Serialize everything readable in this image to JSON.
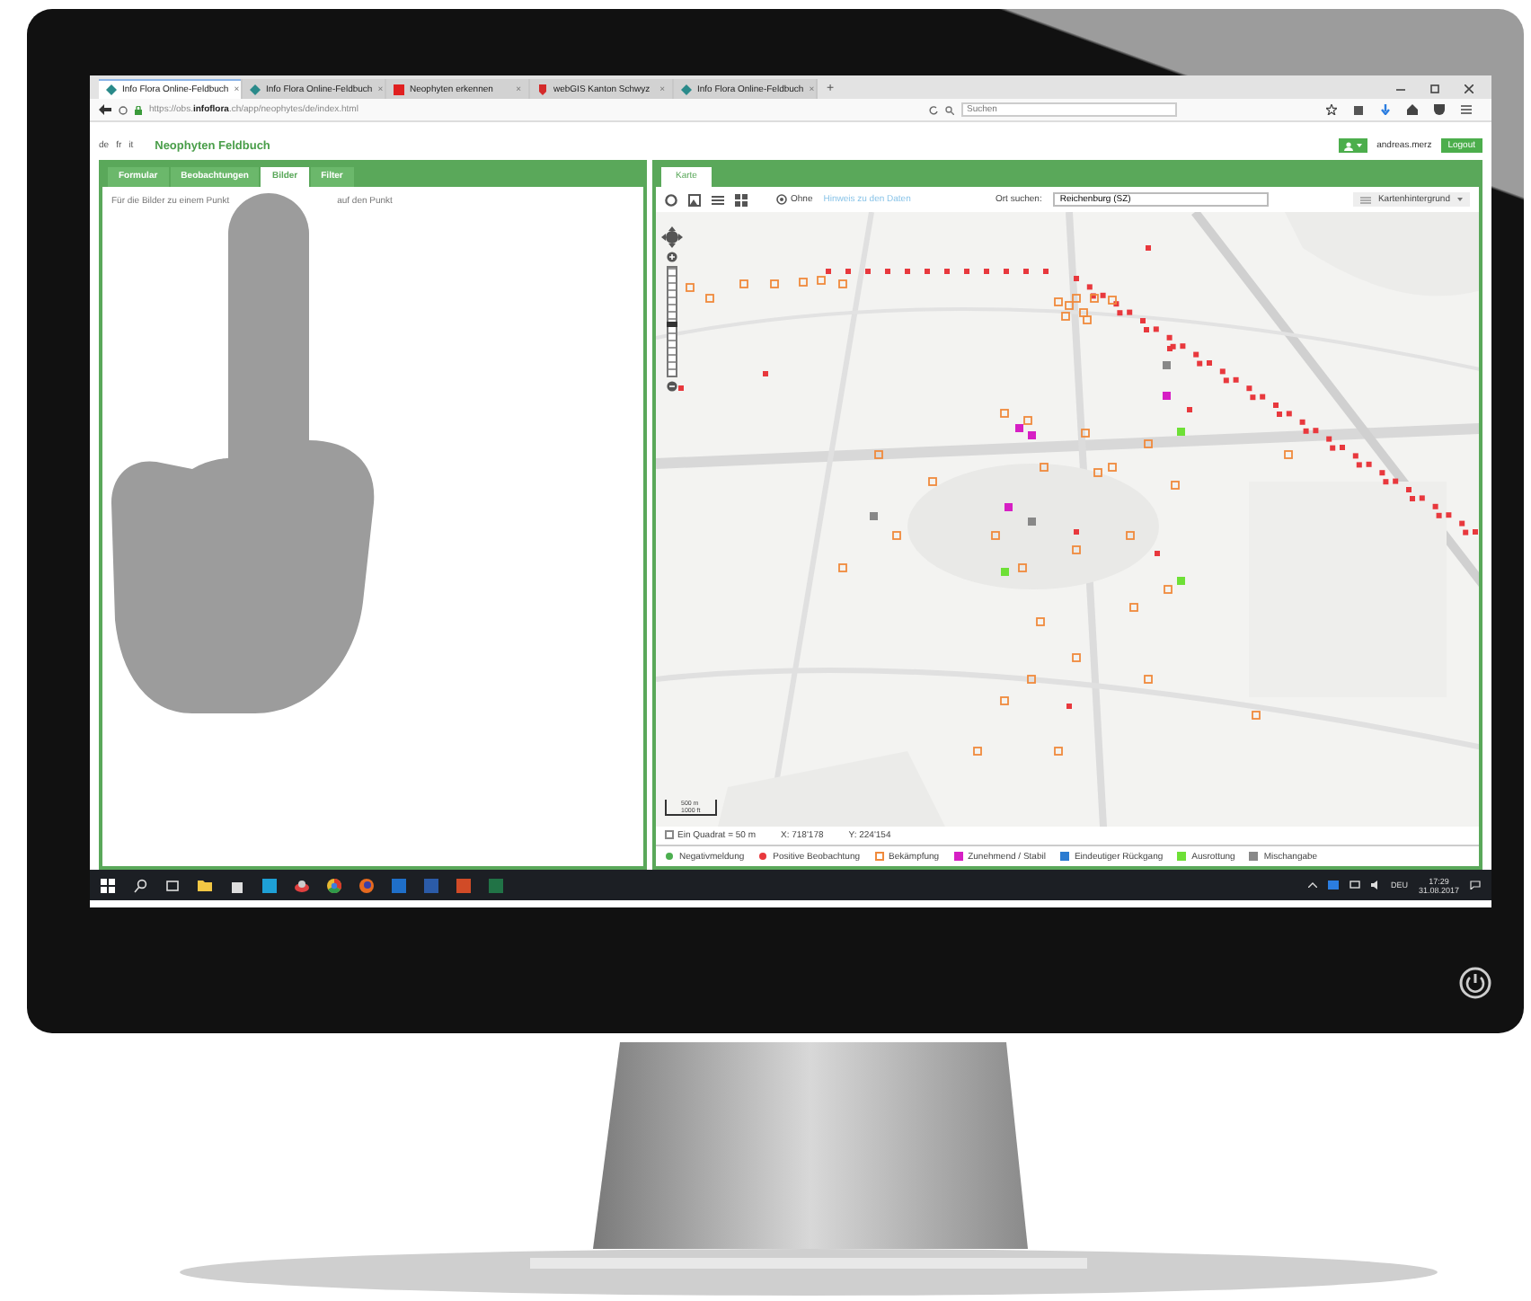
{
  "browser": {
    "tabs": [
      {
        "title": "Info Flora Online-Feldbuch",
        "kind": "leaf",
        "close": "×",
        "selected": true
      },
      {
        "title": "Info Flora Online-Feldbuch",
        "kind": "leaf",
        "close": "×",
        "selected": false
      },
      {
        "title": "Neophyten erkennen",
        "kind": "square",
        "close": "×",
        "selected": false
      },
      {
        "title": "webGIS Kanton Schwyz",
        "kind": "shield",
        "close": "×",
        "selected": false
      },
      {
        "title": "Info Flora Online-Feldbuch",
        "kind": "leaf",
        "close": "×",
        "selected": false
      }
    ],
    "new_tab": "+",
    "url": "https://obs.**infoflora**.ch/app/neophytes/de/index.html",
    "search": {
      "placeholder": "Suchen"
    }
  },
  "app": {
    "languages": [
      "de",
      "fr",
      "it"
    ],
    "title": "Neophyten Feldbuch",
    "user": "andreas.merz",
    "logout": "Logout"
  },
  "left_panel": {
    "tabs": [
      {
        "label": "Formular",
        "selected": false
      },
      {
        "label": "Beobachtungen",
        "selected": false
      },
      {
        "label": "Bilder",
        "selected": true
      },
      {
        "label": "Filter",
        "selected": false
      }
    ],
    "hint_parts": [
      "Für die Bilder zu einem Punkt",
      "auf den Punkt"
    ]
  },
  "map_panel": {
    "tabs": [
      {
        "label": "Karte",
        "selected": true
      }
    ],
    "toolbar": {
      "option": "Ohne",
      "info_link": "Hinweis zu den Daten",
      "place_label": "Ort suchen:",
      "place_value": "Reichenburg (SZ)",
      "background_select": "Kartenhintergrund"
    },
    "zoom": {
      "level": 0.5
    },
    "scale": {
      "top": "500 m",
      "bottom": "1000 ft"
    },
    "grid_toggle": {
      "label": "Ein Quadrat = 50 m",
      "checked": false
    },
    "x": "X: 718'178",
    "y": "Y: 224'154",
    "legend": [
      {
        "label": "Negativmeldung",
        "kind": "dot",
        "color": "#4caf50"
      },
      {
        "label": "Positive Beobachtung",
        "kind": "dot",
        "color": "#e8383d"
      },
      {
        "label": "Bekämpfung",
        "kind": "outline",
        "color": "#f08a3c"
      },
      {
        "label": "Zunehmend / Stabil",
        "kind": "square",
        "color": "#d61fc4"
      },
      {
        "label": "Eindeutiger Rückgang",
        "kind": "square",
        "color": "#2a7bd1"
      },
      {
        "label": "Ausrottung",
        "kind": "square",
        "color": "#6ee036"
      },
      {
        "label": "Mischangabe",
        "kind": "square",
        "color": "#888888"
      }
    ]
  },
  "taskbar": {
    "language": "DEU",
    "time": "17:29",
    "date": "31.08.2017"
  }
}
